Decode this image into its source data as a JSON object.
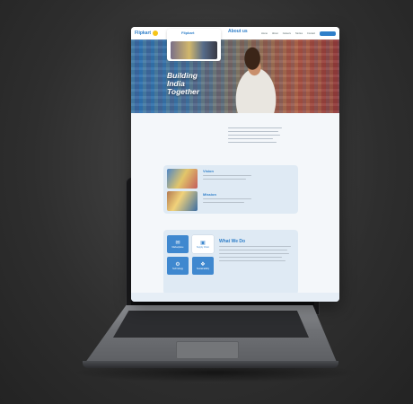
{
  "site": {
    "logo_text": "Flipkart",
    "nav": [
      "Home",
      "About",
      "Careers",
      "Stories",
      "Contact"
    ],
    "nav_button": "Sign in"
  },
  "hero": {
    "title_lines": [
      "Building",
      "India",
      "Together"
    ]
  },
  "about": {
    "title": "About us"
  },
  "vision": {
    "title": "Vision"
  },
  "mission": {
    "title": "Mission"
  },
  "what_we_do": {
    "title": "What We Do",
    "tiles": [
      "Marketplace",
      "Supply Chain",
      "Technology",
      "Sustainability"
    ]
  },
  "colors": {
    "brand_blue": "#2f7fc9",
    "brand_yellow": "#f5c518",
    "panel": "#dfeaf4",
    "background": "#2e2e2e"
  }
}
